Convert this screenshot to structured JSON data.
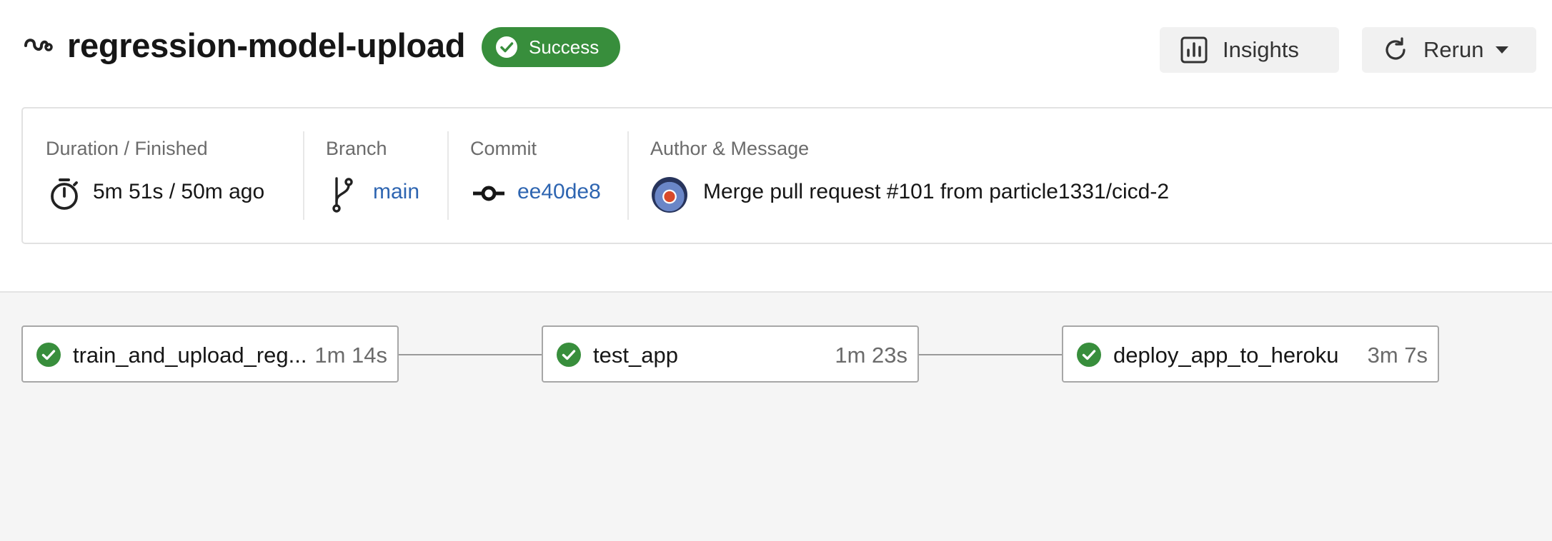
{
  "header": {
    "title": "regression-model-upload",
    "status": "Success",
    "insights_label": "Insights",
    "rerun_label": "Rerun",
    "status_color": "#388e3c"
  },
  "info": {
    "duration_label": "Duration / Finished",
    "duration_value": "5m 51s / 50m ago",
    "branch_label": "Branch",
    "branch_value": "main",
    "commit_label": "Commit",
    "commit_value": "ee40de8",
    "author_label": "Author & Message",
    "message": "Merge pull request #101 from particle1331/cicd-2"
  },
  "jobs": [
    {
      "name": "train_and_upload_reg...",
      "duration": "1m 14s"
    },
    {
      "name": "test_app",
      "duration": "1m 23s"
    },
    {
      "name": "deploy_app_to_heroku",
      "duration": "3m 7s"
    }
  ],
  "icons": [
    "workflow-icon",
    "check-circle-icon",
    "insights-icon",
    "refresh-icon",
    "caret-down-icon",
    "stopwatch-icon",
    "branch-icon",
    "commit-icon"
  ],
  "colors": {
    "link": "#2e65b1",
    "success": "#388e3c",
    "canvas": "#f5f5f5"
  }
}
